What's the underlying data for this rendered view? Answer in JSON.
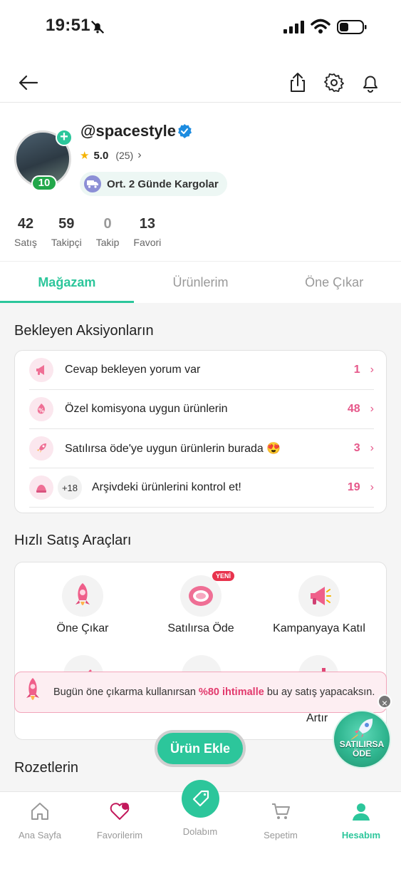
{
  "status_bar": {
    "time": "19:51"
  },
  "profile": {
    "username": "@spacestyle",
    "rating": "5.0",
    "rating_count": "(25)",
    "level": "10",
    "shipping": "Ort. 2 Günde Kargolar",
    "stats": [
      {
        "value": "42",
        "label": "Satış"
      },
      {
        "value": "59",
        "label": "Takipçi"
      },
      {
        "value": "0",
        "label": "Takip"
      },
      {
        "value": "13",
        "label": "Favori"
      }
    ]
  },
  "tabs": [
    {
      "label": "Mağazam",
      "active": true
    },
    {
      "label": "Ürünlerim",
      "active": false
    },
    {
      "label": "Öne Çıkar",
      "active": false
    }
  ],
  "pending": {
    "title": "Bekleyen Aksiyonların",
    "items": [
      {
        "text": "Cevap bekleyen yorum var",
        "count": "1",
        "icon": "megaphone-icon"
      },
      {
        "text": "Özel komisyona uygun ürünlerin",
        "count": "48",
        "icon": "percent-icon"
      },
      {
        "text": "Satılırsa öde'ye uygun ürünlerin burada 😍",
        "count": "3",
        "icon": "rocket-icon"
      },
      {
        "text": "Arşivdeki ürünlerini kontrol et!",
        "count": "19",
        "icon": "archive-icon",
        "extra": "+18"
      }
    ]
  },
  "tools": {
    "title": "Hızlı Satış Araçları",
    "items": [
      {
        "label": "Öne Çıkar",
        "icon": "rocket-icon"
      },
      {
        "label": "Satılırsa Öde",
        "icon": "money-icon",
        "badge": "YENİ"
      },
      {
        "label": "Kampanyaya Katıl",
        "icon": "megaphone-icon"
      }
    ],
    "partial_label": "Artır"
  },
  "toast": {
    "before": "Bugün öne çıkarma kullanırsan ",
    "highlight": "%80 ihtimalle",
    "after": " bu ay satış yapacaksın."
  },
  "floating_badge": {
    "line1": "SATILIRSA",
    "line2": "ÖDE"
  },
  "add_button": "Ürün Ekle",
  "badges_title": "Rozetlerin",
  "bottom_nav": [
    {
      "label": "Ana Sayfa"
    },
    {
      "label": "Favorilerim"
    },
    {
      "label": "Dolabım"
    },
    {
      "label": "Sepetim"
    },
    {
      "label": "Hesabım",
      "active": true
    }
  ],
  "colors": {
    "accent": "#2cc69b",
    "pink": "#e6588a"
  }
}
